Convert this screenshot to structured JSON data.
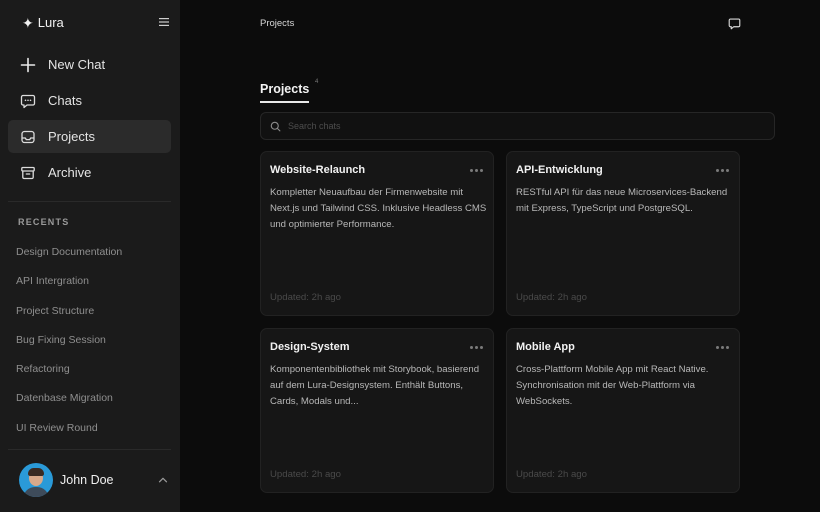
{
  "app": {
    "name": "Lura",
    "logo_glyph": "✦"
  },
  "sidebar": {
    "nav": [
      {
        "label": "New Chat",
        "icon": "plus-icon"
      },
      {
        "label": "Chats",
        "icon": "chat-bubble-icon"
      },
      {
        "label": "Projects",
        "icon": "inbox-icon",
        "active": true
      },
      {
        "label": "Archive",
        "icon": "archive-box-icon"
      }
    ],
    "recents_title": "RECENTS",
    "recents": [
      "Design Documentation",
      "API Intergration",
      "Project Structure",
      "Bug Fixing Session",
      "Refactoring",
      "Datenbase Migration",
      "UI Review Round"
    ],
    "user": {
      "name": "John Doe"
    }
  },
  "header": {
    "breadcrumb": "Projects"
  },
  "main": {
    "tab": {
      "label": "Projects",
      "count": "4"
    },
    "search": {
      "placeholder": "Search chats",
      "value": ""
    },
    "cards": [
      {
        "title": "Website-Relaunch",
        "description": "Kompletter Neuaufbau der Firmenwebsite mit Next.js und Tailwind CSS. Inklusive Headless CMS und optimierter Performance.",
        "updated": "Updated: 2h ago"
      },
      {
        "title": "API-Entwicklung",
        "description": "RESTful API für das neue Microservices-Backend mit Express, TypeScript und PostgreSQL.",
        "updated": "Updated: 2h ago"
      },
      {
        "title": "Design-System",
        "description": "Komponentenbibliothek mit Storybook, basierend auf dem Lura-Designsystem. Enthält Buttons, Cards, Modals und...",
        "updated": "Updated: 2h ago"
      },
      {
        "title": "Mobile App",
        "description": "Cross-Plattform Mobile App mit React Native. Synchronisation mit der Web-Plattform via WebSockets.",
        "updated": "Updated: 2h ago"
      }
    ]
  },
  "colors": {
    "background": "#0c0c0c",
    "sidebar": "#1b1b1b",
    "active_nav": "#2b2b2b",
    "card": "#161616",
    "avatar_bg": "#2a9ad8"
  }
}
